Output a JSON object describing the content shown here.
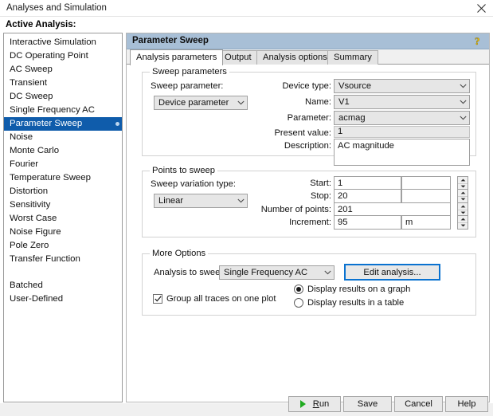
{
  "window": {
    "title": "Analyses and Simulation",
    "close_icon": "close-icon"
  },
  "sidebar": {
    "label": "Active Analysis:",
    "items": [
      {
        "label": "Interactive Simulation",
        "selected": false
      },
      {
        "label": "DC Operating Point",
        "selected": false
      },
      {
        "label": "AC Sweep",
        "selected": false
      },
      {
        "label": "Transient",
        "selected": false
      },
      {
        "label": "DC Sweep",
        "selected": false
      },
      {
        "label": "Single Frequency AC",
        "selected": false
      },
      {
        "label": "Parameter Sweep",
        "selected": true
      },
      {
        "label": "Noise",
        "selected": false
      },
      {
        "label": "Monte Carlo",
        "selected": false
      },
      {
        "label": "Fourier",
        "selected": false
      },
      {
        "label": "Temperature Sweep",
        "selected": false
      },
      {
        "label": "Distortion",
        "selected": false
      },
      {
        "label": "Sensitivity",
        "selected": false
      },
      {
        "label": "Worst Case",
        "selected": false
      },
      {
        "label": "Noise Figure",
        "selected": false
      },
      {
        "label": "Pole Zero",
        "selected": false
      },
      {
        "label": "Transfer Function",
        "selected": false
      },
      {
        "label": "Batched",
        "selected": false
      },
      {
        "label": "User-Defined",
        "selected": false
      }
    ],
    "selected_color": "#0f5cab"
  },
  "panel": {
    "title": "Parameter Sweep",
    "help_icon": "help-question-icon",
    "tabs": [
      {
        "label": "Analysis parameters",
        "active": true
      },
      {
        "label": "Output",
        "active": false
      },
      {
        "label": "Analysis options",
        "active": false
      },
      {
        "label": "Summary",
        "active": false
      }
    ]
  },
  "sweep_parameters": {
    "group_title": "Sweep parameters",
    "sweep_parameter_label": "Sweep parameter:",
    "sweep_parameter_value": "Device parameter",
    "device_type_label": "Device type:",
    "device_type_value": "Vsource",
    "name_label": "Name:",
    "name_value": "V1",
    "parameter_label": "Parameter:",
    "parameter_value": "acmag",
    "present_value_label": "Present value:",
    "present_value_value": "1",
    "description_label": "Description:",
    "description_value": "AC magnitude"
  },
  "points_to_sweep": {
    "group_title": "Points to sweep",
    "variation_type_label": "Sweep variation type:",
    "variation_type_value": "Linear",
    "start_label": "Start:",
    "start_value": "1",
    "start_unit": "",
    "stop_label": "Stop:",
    "stop_value": "20",
    "stop_unit": "",
    "number_of_points_label": "Number of points:",
    "number_of_points_value": "201",
    "increment_label": "Increment:",
    "increment_value": "95",
    "increment_unit": "m"
  },
  "more_options": {
    "group_title": "More Options",
    "analysis_to_sweep_label": "Analysis to sweep:",
    "analysis_to_sweep_value": "Single Frequency AC",
    "edit_analysis_label": "Edit analysis...",
    "group_traces_label": "Group all traces on one plot",
    "group_traces_checked": true,
    "display_graph_label": "Display results on a graph",
    "display_table_label": "Display results in a table",
    "display_selected": "graph"
  },
  "footer": {
    "run_label_prefix": "R",
    "run_label_rest": "un",
    "run_icon": "run-play-icon",
    "save_label": "Save",
    "cancel_label": "Cancel",
    "help_label": "Help"
  }
}
